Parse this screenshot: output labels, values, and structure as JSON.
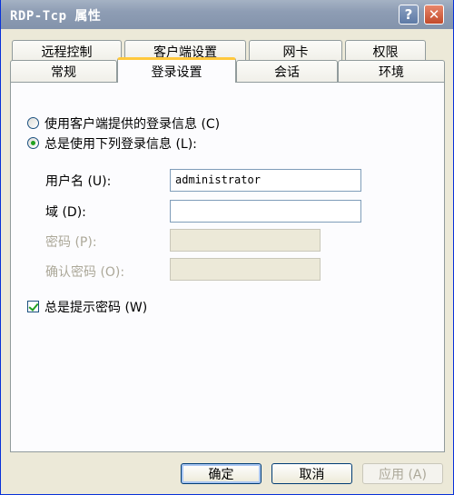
{
  "window": {
    "title": "RDP-Tcp 属性",
    "help_glyph": "?",
    "close_glyph": "✕",
    "help_icon": "question-mark",
    "close_icon": "x-mark"
  },
  "tabs_back": [
    "远程控制",
    "客户端设置",
    "网卡",
    "权限"
  ],
  "tabs_front": [
    "常规",
    "登录设置",
    "会话",
    "环境"
  ],
  "active_tab": "登录设置",
  "logon": {
    "option_client": "使用客户端提供的登录信息 (C)",
    "option_always": "总是使用下列登录信息 (L):",
    "selected_option": "option_always",
    "username_label": "用户名 (U):",
    "username_value": "administrator",
    "domain_label": "域 (D):",
    "domain_value": "",
    "password_label": "密码 (P):",
    "confirm_label": "确认密码 (O):",
    "prompt_password_label": "总是提示密码 (W)",
    "prompt_password_checked": true
  },
  "buttons": {
    "ok": "确定",
    "cancel": "取消",
    "apply": "应用 (A)"
  },
  "colors": {
    "dialog_bg": "#ece9d8",
    "title_bar": "#8e9db4",
    "active_tab_accent": "#ffc83c",
    "check_green": "#21a121"
  }
}
